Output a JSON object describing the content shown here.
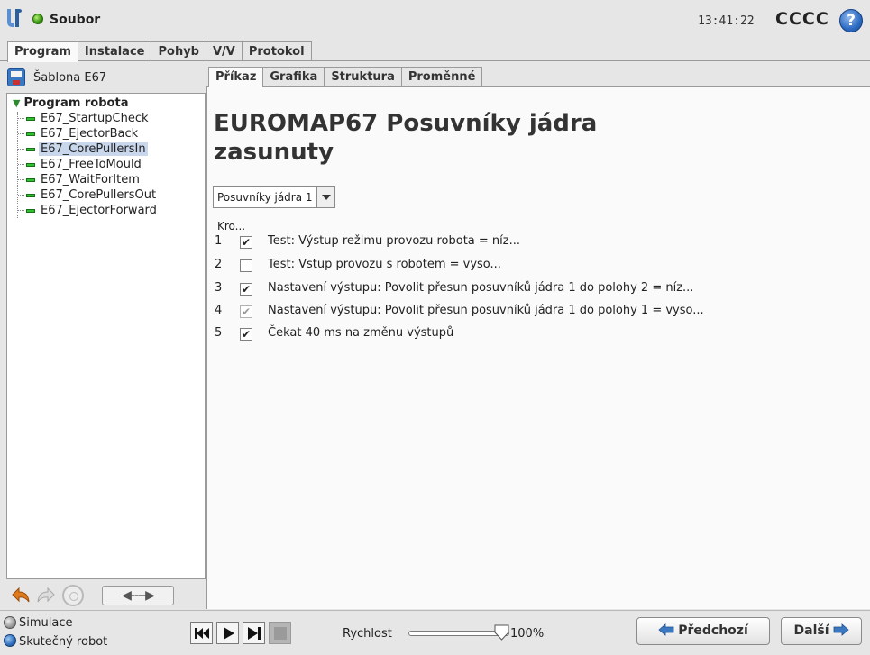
{
  "header": {
    "app_title": "Soubor",
    "time": "13:41:22",
    "robot_name": "CCCC",
    "help_label": "?"
  },
  "main_tabs": [
    "Program",
    "Instalace",
    "Pohyb",
    "V/V",
    "Protokol"
  ],
  "sidebar": {
    "template_label": "Šablona E67",
    "tree_root": "Program robota",
    "tree_items": [
      "E67_StartupCheck",
      "E67_EjectorBack",
      "E67_CorePullersIn",
      "E67_FreeToMould",
      "E67_WaitForItem",
      "E67_CorePullersOut",
      "E67_EjectorForward"
    ],
    "selected_item": "E67_CorePullersIn"
  },
  "sub_tabs": [
    "Příkaz",
    "Grafika",
    "Struktura",
    "Proměnné"
  ],
  "content": {
    "title": "EUROMAP67 Posuvníky jádra zasunuty",
    "dropdown_value": "Posuvníky jádra 1",
    "steps_header": "Kro...",
    "steps": [
      {
        "num": "1",
        "check": "✔",
        "text": "Test: Výstup režimu provozu robota = níz..."
      },
      {
        "num": "2",
        "check": "",
        "text": "Test: Vstup provozu s robotem = vyso..."
      },
      {
        "num": "3",
        "check": "✔",
        "text": "Nastavení výstupu: Povolit přesun posuvníků jádra 1 do polohy 2 = níz..."
      },
      {
        "num": "4",
        "check": "✔",
        "text": "Nastavení výstupu: Povolit přesun posuvníků jádra 1 do polohy 1 = vyso..."
      },
      {
        "num": "5",
        "check": "✔",
        "text": "Čekat 40 ms na změnu výstupů"
      }
    ]
  },
  "footer": {
    "mode_sim": "Simulace",
    "mode_real": "Skutečný robot",
    "speed_label": "Rychlost",
    "speed_value": "100%",
    "speed_fraction": 1.0,
    "prev_label": "Předchozí",
    "next_label": "Další"
  },
  "colors": {
    "accent": "#3a78c2",
    "selected_bg": "#c9d7ec",
    "cmd_green": "#2ec02e"
  }
}
